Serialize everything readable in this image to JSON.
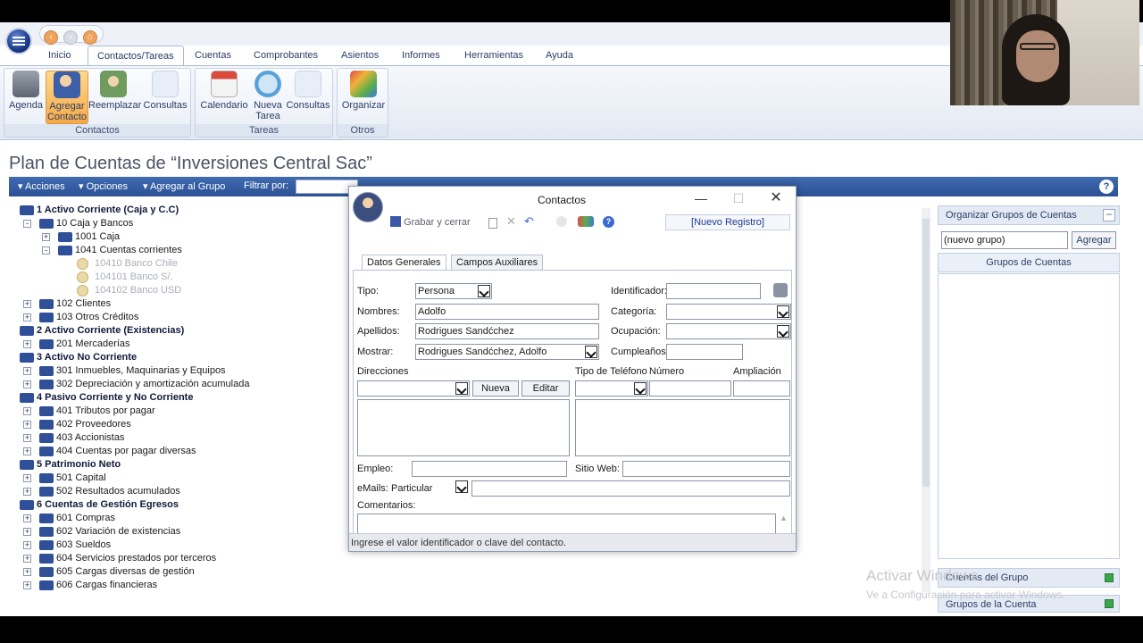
{
  "ribbon_tabs": [
    "Inicio",
    "Contactos/Tareas",
    "Cuentas",
    "Comprobantes",
    "Asientos",
    "Informes",
    "Herramientas",
    "Ayuda"
  ],
  "ribbon": {
    "contactos": {
      "label": "Contactos",
      "buttons": [
        "Agenda",
        "Agregar Contacto",
        "Reemplazar",
        "Consultas"
      ]
    },
    "tareas": {
      "label": "Tareas",
      "buttons": [
        "Calendario",
        "Nueva Tarea",
        "Consultas"
      ]
    },
    "otros": {
      "label": "Otros",
      "buttons": [
        "Organizar"
      ]
    }
  },
  "page_title": "Plan de Cuentas de “Inversiones Central Sac”",
  "toolbar": {
    "acciones": "Acciones",
    "opciones": "Opciones",
    "agregar_grupo": "Agregar al Grupo",
    "filtrar": "Filtrar por:"
  },
  "tree": [
    {
      "text": "1 Activo Corriente (Caja y C.C)",
      "level": 0,
      "kind": "bold"
    },
    {
      "text": "10 Caja y Bancos",
      "level": 1,
      "kind": "folder",
      "exp": "-"
    },
    {
      "text": "1001 Caja",
      "level": 2,
      "kind": "folder",
      "exp": "+"
    },
    {
      "text": "1041 Cuentas corrientes",
      "level": 2,
      "kind": "folder",
      "exp": "-"
    },
    {
      "text": "10410 Banco Chile",
      "level": 3,
      "kind": "dim"
    },
    {
      "text": "104101 Banco S/.",
      "level": 3,
      "kind": "dim"
    },
    {
      "text": "104102 Banco USD",
      "level": 3,
      "kind": "dim"
    },
    {
      "text": "102 Clientes",
      "level": 1,
      "kind": "folder",
      "exp": "+"
    },
    {
      "text": "103 Otros Créditos",
      "level": 1,
      "kind": "folder",
      "exp": "+"
    },
    {
      "text": "2 Activo Corriente (Existencias)",
      "level": 0,
      "kind": "bold"
    },
    {
      "text": "201 Mercaderías",
      "level": 1,
      "kind": "folder",
      "exp": "+"
    },
    {
      "text": "3 Activo No Corriente",
      "level": 0,
      "kind": "bold"
    },
    {
      "text": "301 Inmuebles, Maquinarias y Equipos",
      "level": 1,
      "kind": "folder",
      "exp": "+"
    },
    {
      "text": "302 Depreciación y amortización acumulada",
      "level": 1,
      "kind": "folder",
      "exp": "+"
    },
    {
      "text": "4 Pasivo Corriente y No Corriente",
      "level": 0,
      "kind": "bold"
    },
    {
      "text": "401 Tributos por pagar",
      "level": 1,
      "kind": "folder",
      "exp": "+"
    },
    {
      "text": "402 Proveedores",
      "level": 1,
      "kind": "folder",
      "exp": "+"
    },
    {
      "text": "403 Accionistas",
      "level": 1,
      "kind": "folder",
      "exp": "+"
    },
    {
      "text": "404 Cuentas por pagar diversas",
      "level": 1,
      "kind": "folder",
      "exp": "+"
    },
    {
      "text": "5 Patrimonio Neto",
      "level": 0,
      "kind": "bold"
    },
    {
      "text": "501 Capital",
      "level": 1,
      "kind": "folder",
      "exp": "+"
    },
    {
      "text": "502 Resultados acumulados",
      "level": 1,
      "kind": "folder",
      "exp": "+"
    },
    {
      "text": "6 Cuentas de Gestión Egresos",
      "level": 0,
      "kind": "bold"
    },
    {
      "text": "601 Compras",
      "level": 1,
      "kind": "folder",
      "exp": "+"
    },
    {
      "text": "602 Variación de existencias",
      "level": 1,
      "kind": "folder",
      "exp": "+"
    },
    {
      "text": "603 Sueldos",
      "level": 1,
      "kind": "folder",
      "exp": "+"
    },
    {
      "text": "604 Servicios prestados por terceros",
      "level": 1,
      "kind": "folder",
      "exp": "+"
    },
    {
      "text": "605 Cargas diversas de gestión",
      "level": 1,
      "kind": "folder",
      "exp": "+"
    },
    {
      "text": "606 Cargas financieras",
      "level": 1,
      "kind": "folder",
      "exp": "+"
    }
  ],
  "right_panel": {
    "organizar": "Organizar Grupos de Cuentas",
    "nuevo_grupo": "(nuevo grupo)",
    "agregar": "Agregar",
    "grupos": "Grupos de Cuentas",
    "cuentas_del_grupo": "Cuentas del Grupo",
    "grupos_de_la_cuenta": "Grupos de la Cuenta"
  },
  "dialog": {
    "title": "Contactos",
    "grabar": "Grabar y cerrar",
    "nuevo_registro": "[Nuevo Registro]",
    "tabs": [
      "Datos Generales",
      "Campos Auxiliares"
    ],
    "labels": {
      "tipo": "Tipo:",
      "nombres": "Nombres:",
      "apellidos": "Apellidos:",
      "mostrar": "Mostrar:",
      "identificador": "Identificador:",
      "categoria": "Categoría:",
      "ocupacion": "Ocupación:",
      "cumpleanos": "Cumpleaños:",
      "direcciones": "Direcciones",
      "tipo_telefono": "Tipo de Teléfono",
      "numero": "Número",
      "ampliacion": "Ampliación",
      "empleo": "Empleo:",
      "sitio_web": "Sitio Web:",
      "emails": "eMails:",
      "particular": "Particular",
      "comentarios": "Comentarios:"
    },
    "values": {
      "tipo": "Persona",
      "nombres": "Adolfo",
      "apellidos": "Rodrigues Sandćchez",
      "mostrar": "Rodrigues Sandćchez, Adolfo"
    },
    "buttons": {
      "nueva": "Nueva",
      "editar": "Editar"
    },
    "status": "Ingrese el valor identificador o clave del contacto."
  },
  "watermark": {
    "line1": "Activar Windows",
    "line2": "Ve a Configuración para activar Windows."
  },
  "colors": {
    "ribbon_selected": "#f5a94a",
    "toolbar": "#2b5196",
    "folder": "#2f4f98"
  }
}
